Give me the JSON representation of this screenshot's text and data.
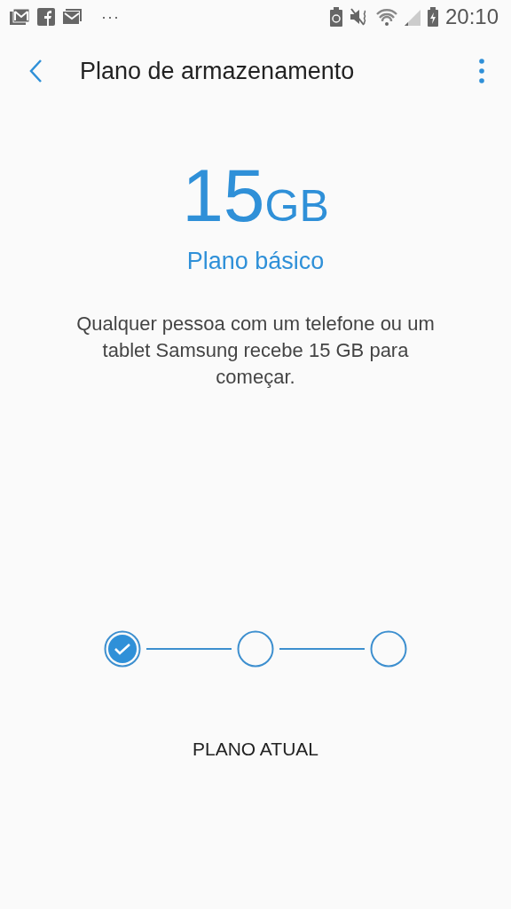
{
  "status_bar": {
    "overflow": "···",
    "time": "20:10"
  },
  "header": {
    "title": "Plano de armazenamento"
  },
  "plan": {
    "amount": "15",
    "unit": "GB",
    "name": "Plano básico",
    "description": "Qualquer pessoa com um telefone ou um tablet Samsung recebe 15 GB para começar."
  },
  "steps": [
    {
      "selected": true
    },
    {
      "selected": false
    },
    {
      "selected": false
    }
  ],
  "step_label": "PLANO ATUAL"
}
